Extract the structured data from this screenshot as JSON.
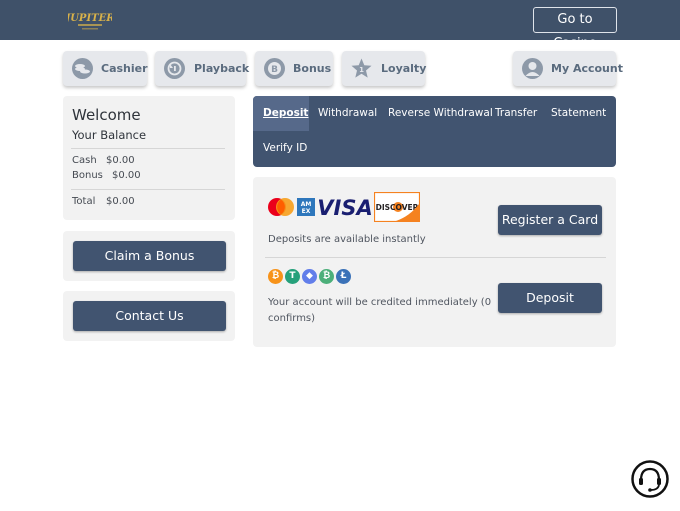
{
  "header": {
    "logo_text": "JUPITER",
    "goto_label": "Go to Casino"
  },
  "nav": {
    "cashier": "Cashier",
    "playback": "Playback",
    "bonus": "Bonus",
    "loyalty": "Loyalty",
    "account": "My Account"
  },
  "welcome": {
    "title": "Welcome",
    "balance_label": "Your Balance",
    "cash_label": "Cash",
    "cash_value": "$0.00",
    "bonus_label": "Bonus",
    "bonus_value": "$0.00",
    "total_label": "Total",
    "total_value": "$0.00"
  },
  "claim_bonus": "Claim a Bonus",
  "contact_us": "Contact Us",
  "tabs": {
    "deposit": "Deposit",
    "withdrawal": "Withdrawal",
    "reverse": "Reverse Withdrawal",
    "transfer": "Transfer",
    "statement": "Statement",
    "verify": "Verify ID"
  },
  "cards": {
    "amex_label": "AM EX",
    "visa_label": "VISA",
    "discover_label": "DISCOVER",
    "info": "Deposits are available instantly",
    "register_label": "Register a Card"
  },
  "crypto": {
    "coins": [
      "₿",
      "T",
      "◆",
      "₿",
      "Ł"
    ],
    "info_line1": "Your account will be credited immediately (0",
    "info_line2": "confirms)",
    "deposit_label": "Deposit"
  },
  "colors": {
    "header": "#3f5169",
    "button": "#415470",
    "tab_active": "#56698a"
  },
  "icons": [
    "cashier-coins-icon",
    "playback-icon",
    "bonus-coin-icon",
    "loyalty-star-icon",
    "account-user-icon",
    "support-chat-icon"
  ]
}
